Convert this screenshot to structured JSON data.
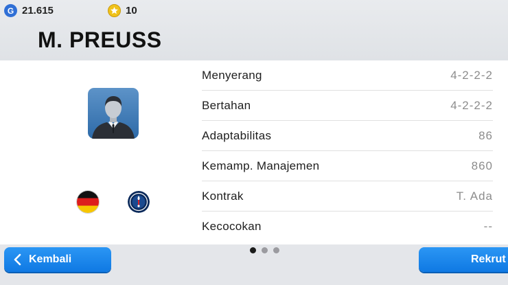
{
  "currency": {
    "gp": {
      "icon": "gp-icon",
      "icon_letter": "G",
      "value": "21.615"
    },
    "coins": {
      "icon": "coin-icon",
      "value": "10"
    }
  },
  "manager": {
    "name": "M. PREUSS"
  },
  "stats": [
    {
      "label": "Menyerang",
      "value": "4-2-2-2"
    },
    {
      "label": "Bertahan",
      "value": "4-2-2-2"
    },
    {
      "label": "Adaptabilitas",
      "value": "86"
    },
    {
      "label": "Kemamp. Manajemen",
      "value": "860"
    },
    {
      "label": "Kontrak",
      "value": "T. Ada"
    },
    {
      "label": "Kecocokan",
      "value": "--"
    }
  ],
  "pager": {
    "total": 3,
    "active": 1
  },
  "buttons": {
    "back_label": "Kembali",
    "recruit_label": "Rekrut"
  },
  "colors": {
    "button_blue": "#1687ee",
    "gp_blue": "#2f6fd6",
    "coin_gold": "#f0c21a"
  }
}
